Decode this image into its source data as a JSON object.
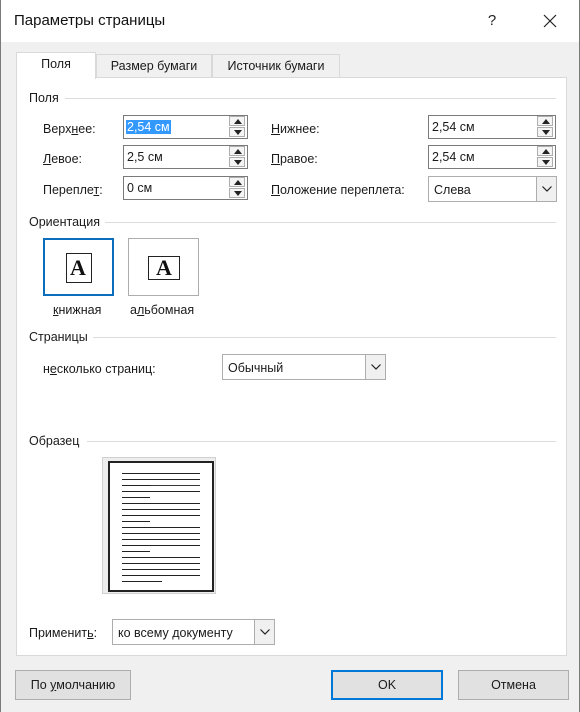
{
  "dialog": {
    "title": "Параметры страницы",
    "help_label": "?",
    "close_label": "✕"
  },
  "tabs": [
    {
      "label": "Поля",
      "active": true
    },
    {
      "label": "Размер бумаги",
      "active": false
    },
    {
      "label": "Источник бумаги",
      "active": false
    }
  ],
  "margins": {
    "group_label": "Поля",
    "top": {
      "label_pre": "Верх",
      "label_acc": "н",
      "label_post": "ее:",
      "value": "2,54 см"
    },
    "bottom": {
      "label_pre": "",
      "label_acc": "Н",
      "label_post": "ижнее:",
      "value": "2,54 см"
    },
    "left": {
      "label_pre": "",
      "label_acc": "Л",
      "label_post": "евое:",
      "value": "2,5 см"
    },
    "right": {
      "label_pre": "",
      "label_acc": "П",
      "label_post": "равое:",
      "value": "2,54 см"
    },
    "gutter": {
      "label_pre": "Перепле",
      "label_acc": "т",
      "label_post": ":",
      "value": "0 см"
    },
    "gutter_position": {
      "label_pre": "",
      "label_acc": "П",
      "label_post": "оложение переплета:",
      "value": "Слева"
    }
  },
  "orientation": {
    "group_label": "Ориентация",
    "portrait": {
      "label_pre": "",
      "label_acc": "к",
      "label_post": "нижная",
      "glyph": "A",
      "icon": "portrait-page-icon"
    },
    "landscape": {
      "label_pre": "а",
      "label_acc": "л",
      "label_post": "ьбомная",
      "glyph": "A",
      "icon": "landscape-page-icon"
    }
  },
  "pages": {
    "group_label": "Страницы",
    "multiple": {
      "label_pre": "н",
      "label_acc": "е",
      "label_post": "сколько страниц:",
      "value": "Обычный"
    }
  },
  "preview": {
    "group_label": "Образец"
  },
  "apply": {
    "label_pre": "Применит",
    "label_acc": "ь",
    "label_post": ":",
    "value": "ко всему документу"
  },
  "buttons": {
    "default": {
      "label_pre": "По ",
      "label_acc": "у",
      "label_post": "молчанию"
    },
    "ok": "OK",
    "cancel": "Отмена"
  },
  "colors": {
    "selection": "#3399ff",
    "focus_border": "#0078d7",
    "dialog_bg": "#f0f0f0"
  }
}
